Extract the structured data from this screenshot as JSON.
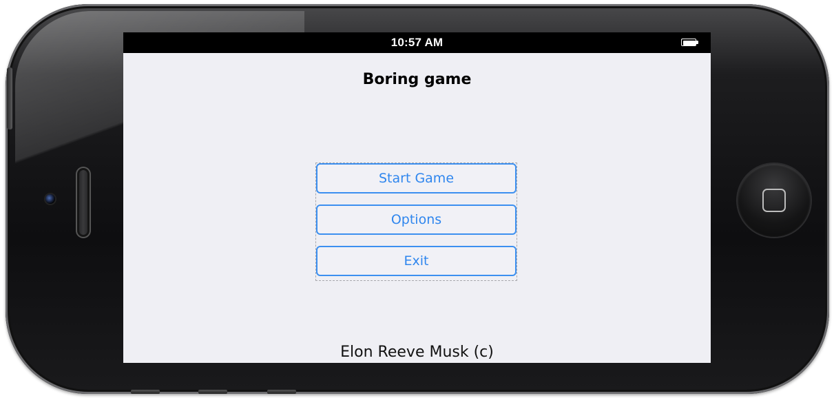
{
  "status_bar": {
    "time": "10:57 AM"
  },
  "app": {
    "title": "Boring game"
  },
  "menu": {
    "items": [
      {
        "label": "Start Game"
      },
      {
        "label": "Options"
      },
      {
        "label": "Exit"
      }
    ]
  },
  "footer": {
    "credit": "Elon Reeve Musk (c)"
  },
  "colors": {
    "accent": "#2f86ee",
    "screen_background": "#efeff4",
    "device_body": "#0e0e10"
  }
}
